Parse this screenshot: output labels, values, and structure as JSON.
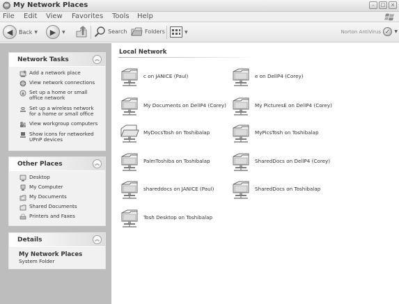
{
  "window": {
    "title": "My Network Places"
  },
  "menu": [
    "File",
    "Edit",
    "View",
    "Favorites",
    "Tools",
    "Help"
  ],
  "toolbar": {
    "back_label": "Back",
    "search_label": "Search",
    "folders_label": "Folders",
    "norton_label": "Norton AntiVirus"
  },
  "network_tasks": {
    "title": "Network Tasks",
    "items": [
      {
        "label": "Add a network place",
        "icon": "add-network-place-icon"
      },
      {
        "label": "View network connections",
        "icon": "network-connections-icon"
      },
      {
        "label": "Set up a home or small office network",
        "icon": "home-network-icon"
      },
      {
        "label": "Set up a wireless network for a home or small office",
        "icon": "wireless-network-icon"
      },
      {
        "label": "View workgroup computers",
        "icon": "workgroup-icon"
      },
      {
        "label": "Show icons for networked UPnP devices",
        "icon": "upnp-icon"
      }
    ]
  },
  "other_places": {
    "title": "Other Places",
    "items": [
      {
        "label": "Desktop",
        "icon": "desktop-icon"
      },
      {
        "label": "My Computer",
        "icon": "my-computer-icon"
      },
      {
        "label": "My Documents",
        "icon": "my-documents-icon"
      },
      {
        "label": "Shared Documents",
        "icon": "shared-documents-icon"
      },
      {
        "label": "Printers and Faxes",
        "icon": "printer-icon"
      }
    ]
  },
  "details": {
    "title": "Details",
    "name": "My Network Places",
    "type": "System Folder"
  },
  "main": {
    "section_title": "Local Network",
    "shares": [
      "c on JANICE (Paul)",
      "e on DellP4 (Corey)",
      "My Documents on DellP4 (Corey)",
      "My PicturesE on DellP4 (Corey)",
      "MyDocsTosh on Toshibalap",
      "MyPicsTosh on Toshibalap",
      "PalmToshiba on Toshibalap",
      "SharedDocs on DellP4 (Corey)",
      "shareddocs on JANICE (Paul)",
      "SharedDocs on Toshibalap",
      "Tosh Desktop on Toshibalap"
    ]
  }
}
